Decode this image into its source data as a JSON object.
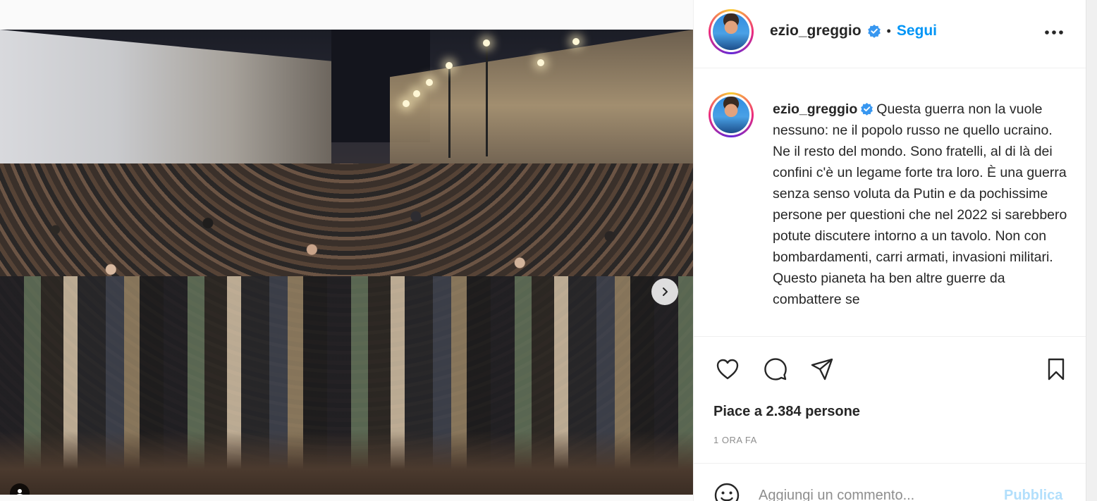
{
  "post": {
    "username": "ezio_greggio",
    "separator": "•",
    "follow_label": "Segui",
    "caption": "Questa guerra non la vuole nessuno: ne il popolo russo ne quello ucraino. Ne il resto del mondo. Sono fratelli, al di là dei confini c'è un legame forte tra loro. È una guerra senza senso voluta da Putin e da pochissime persone per questioni che nel 2022 si sarebbero potute discutere intorno a un tavolo. Non con bombardamenti, carri armati, invasioni militari. Questo pianeta ha ben altre guerre da combattere se",
    "likes": "Piace a 2.384 persone",
    "time": "1 ORA FA"
  },
  "comment": {
    "placeholder": "Aggiungi un commento...",
    "publish_label": "Pubblica"
  },
  "carousel": {
    "total_slides": 2,
    "active_slide": 1
  },
  "icons": {
    "verified": "verified-badge-icon",
    "more": "more-options-icon",
    "like": "heart-icon",
    "comment": "comment-bubble-icon",
    "share": "paper-plane-icon",
    "save": "bookmark-icon",
    "emoji": "emoji-icon",
    "next": "chevron-right-icon",
    "tag": "user-tag-icon"
  },
  "colors": {
    "accent": "#0095f6",
    "publish_disabled": "#b2dffc",
    "verified": "#3897f0",
    "muted": "#8e8e8e",
    "text": "#262626"
  }
}
